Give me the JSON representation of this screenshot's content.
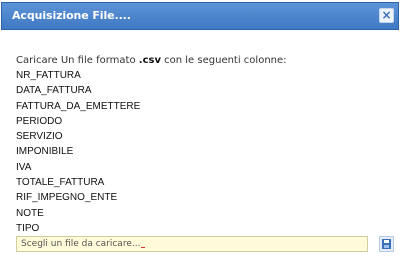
{
  "window": {
    "title": "Acquisizione File....",
    "close_label": "×"
  },
  "instructions": {
    "prefix": "Caricare Un file formato ",
    "format": ".csv",
    "suffix": " con le seguenti colonne:"
  },
  "columns": [
    "NR_FATTURA",
    "DATA_FATTURA",
    "FATTURA_DA_EMETTERE",
    "PERIODO",
    "SERVIZIO",
    "IMPONIBILE",
    "IVA",
    "TOTALE_FATTURA",
    "RIF_IMPEGNO_ENTE",
    "NOTE",
    "TIPO"
  ],
  "file_input": {
    "placeholder": "Scegli un file da caricare..."
  },
  "icons": {
    "close": "close-icon",
    "browse": "save-disk-icon"
  },
  "colors": {
    "titlebar": "#3f79c4",
    "input_background": "#fffbd9"
  }
}
